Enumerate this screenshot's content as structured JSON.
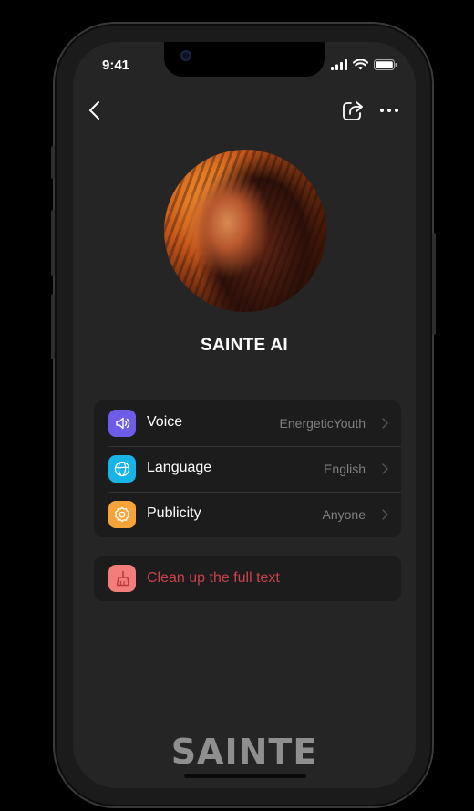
{
  "status_bar": {
    "time": "9:41"
  },
  "profile": {
    "name": "SAINTE AI"
  },
  "settings": [
    {
      "label": "Voice",
      "value": "EnergeticYouth",
      "icon": "speaker-icon",
      "icon_color": "#6c5ce7"
    },
    {
      "label": "Language",
      "value": "English",
      "icon": "globe-icon",
      "icon_color": "#17b4e8"
    },
    {
      "label": "Publicity",
      "value": "Anyone",
      "icon": "gear-icon",
      "icon_color": "#f6a43a"
    }
  ],
  "clean_action": {
    "label": "Clean up the full text",
    "icon": "broom-icon",
    "icon_color": "#f27d7a"
  },
  "brand": {
    "logo_text": "SAINTE"
  },
  "colors": {
    "screen_bg": "#252525",
    "card_bg": "#1c1c1c",
    "danger": "#c9434b"
  }
}
